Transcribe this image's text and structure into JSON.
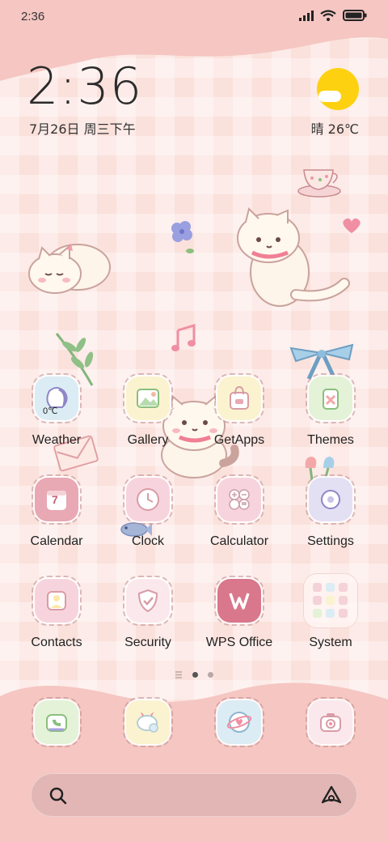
{
  "status_bar": {
    "time": "2:36"
  },
  "clock_widget": {
    "time": "2:36",
    "date": "7月26日 周三下午"
  },
  "weather_widget": {
    "condition_temp": "晴 26℃"
  },
  "apps": [
    {
      "label": "Weather",
      "badge": "0℃"
    },
    {
      "label": "Gallery"
    },
    {
      "label": "GetApps"
    },
    {
      "label": "Themes"
    },
    {
      "label": "Calendar",
      "badge": "7"
    },
    {
      "label": "Clock"
    },
    {
      "label": "Calculator"
    },
    {
      "label": "Settings"
    },
    {
      "label": "Contacts"
    },
    {
      "label": "Security"
    },
    {
      "label": "WPS Office"
    },
    {
      "label": "System"
    }
  ],
  "dock": [
    {
      "name": "phone-app"
    },
    {
      "name": "messages-app"
    },
    {
      "name": "browser-app"
    },
    {
      "name": "camera-app"
    }
  ],
  "pages": {
    "count": 2,
    "current": 1
  },
  "colors": {
    "background": "#fbe1db",
    "wave": "#f5c6c2",
    "sun": "#fdd10f",
    "icon_pink": "#f7d4dd",
    "icon_green": "#e4f2d8",
    "icon_blue": "#dcecf4",
    "icon_yellow": "#fbf3cf",
    "icon_red": "#e8a8b4"
  }
}
